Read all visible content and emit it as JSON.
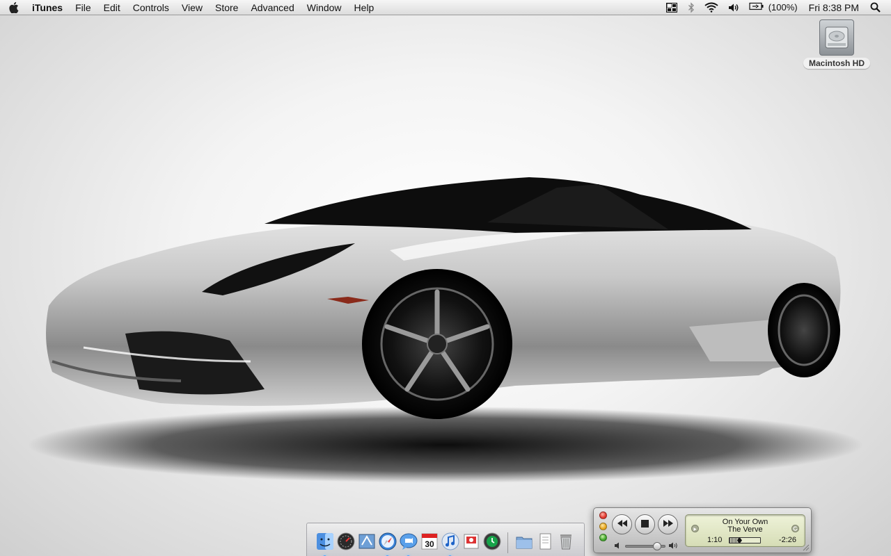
{
  "menubar": {
    "app_name": "iTunes",
    "items": [
      "File",
      "Edit",
      "Controls",
      "View",
      "Store",
      "Advanced",
      "Window",
      "Help"
    ],
    "battery_text": "(100%)",
    "clock": "Fri 8:38 PM",
    "extras": [
      "spaces-icon",
      "bluetooth-icon",
      "wifi-icon",
      "volume-icon",
      "battery-icon",
      "spotlight-icon"
    ]
  },
  "desktop": {
    "icons": [
      {
        "label": "Macintosh HD",
        "icon": "hard-drive-icon"
      }
    ]
  },
  "dock": {
    "apps": [
      {
        "name": "Finder",
        "icon": "finder-icon",
        "running": true
      },
      {
        "name": "Dashboard",
        "icon": "dashboard-icon",
        "running": false
      },
      {
        "name": "Mail",
        "icon": "mail-icon",
        "running": false
      },
      {
        "name": "Safari",
        "icon": "safari-icon",
        "running": true
      },
      {
        "name": "iChat",
        "icon": "ichat-icon",
        "running": true
      },
      {
        "name": "iCal",
        "icon": "ical-icon",
        "running": false,
        "badge": "30"
      },
      {
        "name": "iTunes",
        "icon": "itunes-icon",
        "running": true
      },
      {
        "name": "Preview",
        "icon": "preview-icon",
        "running": false
      },
      {
        "name": "Time Machine",
        "icon": "time-machine-icon",
        "running": false
      }
    ],
    "stacks": [
      {
        "name": "Applications",
        "icon": "applications-folder-icon"
      },
      {
        "name": "Documents",
        "icon": "documents-stack-icon"
      },
      {
        "name": "Trash",
        "icon": "trash-icon"
      }
    ]
  },
  "mini_player": {
    "song": "On Your Own",
    "artist": "The Verve",
    "elapsed": "1:10",
    "remaining": "-2:26",
    "progress": 0.32,
    "volume": 0.8,
    "state": "playing"
  },
  "colors": {
    "accent": "#4aa3ff",
    "lcd": "#e3e8c6"
  }
}
